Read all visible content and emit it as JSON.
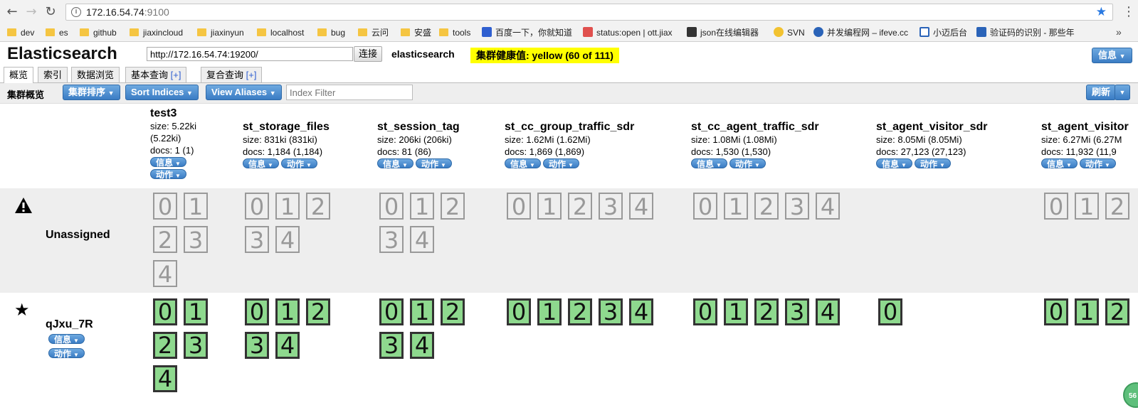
{
  "browser": {
    "url_host": "172.16.54.74",
    "url_port": ":9100",
    "bookmarks": [
      "dev",
      "es",
      "github",
      "jiaxincloud",
      "jiaxinyun",
      "localhost",
      "bug",
      "云问",
      "安盛",
      "tools",
      "百度一下，你就知道",
      "status:open | ott.jiax",
      "json在线编辑器",
      "SVN",
      "并发编程网 – ifeve.cc",
      "小迈后台",
      "验证码的识别 - 那些年"
    ],
    "more": "»"
  },
  "header": {
    "title": "Elasticsearch",
    "connect_url": "http://172.16.54.74:19200/",
    "connect_label": "连接",
    "cluster_name": "elasticsearch",
    "health": "集群健康值: yellow (60 of 111)",
    "info_label": "信息"
  },
  "tabs": [
    {
      "label": "概览"
    },
    {
      "label": "索引"
    },
    {
      "label": "数据浏览"
    },
    {
      "label": "基本查询",
      "plus": "[+]"
    },
    {
      "label": "复合查询",
      "plus": "[+]"
    }
  ],
  "subbar": {
    "title": "集群概览",
    "sort_label": "集群排序",
    "sort_indices_label": "Sort Indices",
    "view_aliases_label": "View Aliases",
    "filter_placeholder": "Index Filter",
    "refresh_label": "刷新"
  },
  "pills": {
    "info": "信息",
    "action": "动作"
  },
  "indices": [
    {
      "name": "test3",
      "size": "size: 5.22ki",
      "size_paren": "(5.22ki)",
      "docs": "docs: 1 (1)"
    },
    {
      "name": "st_storage_files",
      "size": "size: 831ki (831ki)",
      "docs": "docs: 1,184 (1,184)"
    },
    {
      "name": "st_session_tag",
      "size": "size: 206ki (206ki)",
      "docs": "docs: 81 (86)"
    },
    {
      "name": "st_cc_group_traffic_sdr",
      "size": "size: 1.62Mi (1.62Mi)",
      "docs": "docs: 1,869 (1,869)"
    },
    {
      "name": "st_cc_agent_traffic_sdr",
      "size": "size: 1.08Mi (1.08Mi)",
      "docs": "docs: 1,530 (1,530)"
    },
    {
      "name": "st_agent_visitor_sdr",
      "size": "size: 8.05Mi (8.05Mi)",
      "docs": "docs: 27,123 (27,123)"
    },
    {
      "name": "st_agent_visitor",
      "size": "size: 6.27Mi (6.27M",
      "docs": "docs: 11,932 (11,9"
    }
  ],
  "rows": {
    "unassigned_label": "Unassigned",
    "node_label": "qJxu_7R"
  },
  "shards": {
    "test3": {
      "unassigned": [
        "0",
        "1",
        "2",
        "3",
        "4"
      ],
      "assigned": [
        "0",
        "1",
        "2",
        "3",
        "4"
      ]
    },
    "st_storage_files": {
      "unassigned": [
        "0",
        "1",
        "2",
        "3",
        "4"
      ],
      "assigned": [
        "0",
        "1",
        "2",
        "3",
        "4"
      ]
    },
    "st_session_tag": {
      "unassigned": [
        "0",
        "1",
        "2",
        "3",
        "4"
      ],
      "assigned": [
        "0",
        "1",
        "2",
        "3",
        "4"
      ]
    },
    "st_cc_group_traffic_sdr": {
      "unassigned": [
        "0",
        "1",
        "2",
        "3",
        "4"
      ],
      "assigned": [
        "0",
        "1",
        "2",
        "3",
        "4"
      ]
    },
    "st_cc_agent_traffic_sdr": {
      "unassigned": [
        "0",
        "1",
        "2",
        "3",
        "4"
      ],
      "assigned": [
        "0",
        "1",
        "2",
        "3",
        "4"
      ]
    },
    "st_agent_visitor_sdr": {
      "unassigned": [],
      "assigned": [
        "0"
      ]
    },
    "st_agent_visitor": {
      "unassigned": [
        "0",
        "1",
        "2"
      ],
      "assigned": [
        "0",
        "1",
        "2"
      ]
    }
  },
  "badge": "56",
  "colors": {
    "health": "#ffff00",
    "assigned_shard": "#8ed98e",
    "button": "#3a7cc4"
  }
}
